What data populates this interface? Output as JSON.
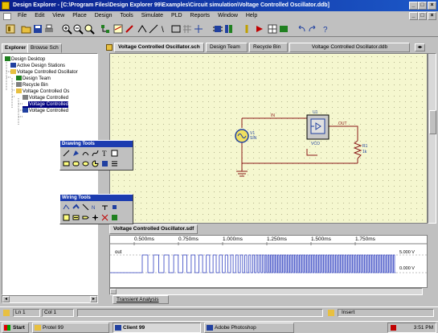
{
  "window": {
    "title": "Design Explorer - [C:\\Program Files\\Design Explorer 99\\Examples\\Circuit simulation\\Voltage Controlled Oscillator.ddb]",
    "controls": [
      "_",
      "□",
      "×"
    ],
    "doc_controls": [
      "_",
      "□",
      "×"
    ]
  },
  "menu": [
    "File",
    "Edit",
    "View",
    "Place",
    "Design",
    "Tools",
    "Simulate",
    "PLD",
    "Reports",
    "Window",
    "Help"
  ],
  "left_panel": {
    "tabs": [
      "Explorer",
      "Browse Sch"
    ],
    "tree": [
      {
        "label": "Design Desktop"
      },
      {
        "label": "Active Design Stations"
      },
      {
        "label": "Voltage Controlled Oscillator"
      },
      {
        "label": "Design Team"
      },
      {
        "label": "Recycle Bin"
      },
      {
        "label": "Voltage Controlled Os"
      },
      {
        "label": "Voltage Controlled"
      },
      {
        "label": "Voltage Controlled"
      },
      {
        "label": "Voltage Controlled"
      }
    ]
  },
  "doc_tabs": [
    "Voltage Controlled Oscillator.sch",
    "Design Team",
    "Recycle Bin",
    "Voltage Controlled Oscillator.ddb"
  ],
  "schematic": {
    "labels": {
      "net_top": "IN",
      "net_out": "OUT",
      "source_name": "V1",
      "source_value": "SIN",
      "part_name": "U1",
      "part_value": "VCO",
      "resistor_name": "R1",
      "resistor_value": "1k"
    }
  },
  "palettes": {
    "drawing": {
      "title": "Drawing Tools"
    },
    "wiring": {
      "title": "Wiring Tools"
    }
  },
  "wave": {
    "tab": "Voltage Controlled Oscillator.sdf",
    "times": [
      "0.500ms",
      "0.750ms",
      "1.000ms",
      "1.250ms",
      "1.500ms",
      "1.750ms"
    ],
    "trace_name": "out",
    "levels": [
      "5.000 V",
      "0.000 V"
    ],
    "bottom_tab": "Transient Analysis"
  },
  "status": {
    "position": "Ln 1",
    "column": "Col 1",
    "mode": "Insert"
  },
  "taskbar": {
    "start": "Start",
    "tasks": [
      "Protel 99",
      "Client 99",
      "Adobe Photoshop"
    ],
    "clock": "3:51 PM"
  },
  "colors": {
    "titlebar": "#0a1e8c",
    "canvas": "#f5f7cf",
    "wire": "#8b1a1a",
    "component": "#2040a0",
    "waveform": "#3040c0"
  }
}
